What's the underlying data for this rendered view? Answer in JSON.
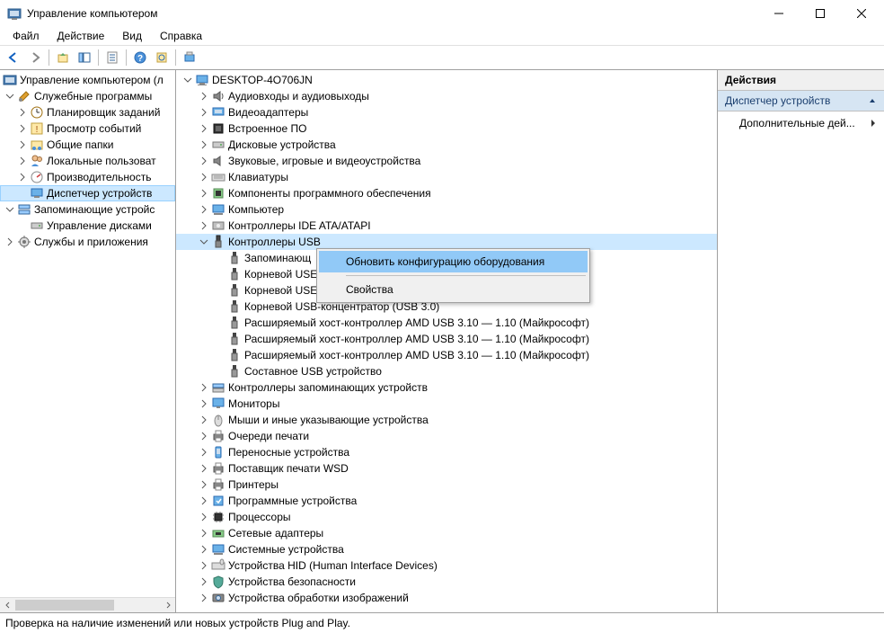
{
  "window": {
    "title": "Управление компьютером"
  },
  "menubar": {
    "file": "Файл",
    "action": "Действие",
    "view": "Вид",
    "help": "Справка"
  },
  "left_tree": {
    "root": "Управление компьютером (л",
    "system_tools": "Служебные программы",
    "task_scheduler": "Планировщик заданий",
    "event_viewer": "Просмотр событий",
    "shared_folders": "Общие папки",
    "local_users": "Локальные пользоват",
    "performance": "Производительность",
    "device_manager": "Диспетчер устройств",
    "storage": "Запоминающие устройс",
    "disk_mgmt": "Управление дисками",
    "services_apps": "Службы и приложения"
  },
  "device_tree": {
    "computer": "DESKTOP-4O706JN",
    "audio": "Аудиовходы и аудиовыходы",
    "video": "Видеоадаптеры",
    "firmware": "Встроенное ПО",
    "disk": "Дисковые устройства",
    "sound": "Звуковые, игровые и видеоустройства",
    "keyboards": "Клавиатуры",
    "software_components": "Компоненты программного обеспечения",
    "computer_cat": "Компьютер",
    "ide": "Контроллеры IDE ATA/ATAPI",
    "usb_controllers": "Контроллеры USB",
    "usb_mass": "Запоминающ",
    "usb_root1": "Корневой USE",
    "usb_root2": "Корневой USE",
    "usb_root3": "Корневой USB-концентратор (USB 3.0)",
    "usb_amd1": "Расширяемый хост-контроллер AMD USB 3.10 — 1.10 (Майкрософт)",
    "usb_amd2": "Расширяемый хост-контроллер AMD USB 3.10 — 1.10 (Майкрософт)",
    "usb_amd3": "Расширяемый хост-контроллер AMD USB 3.10 — 1.10 (Майкрософт)",
    "usb_composite": "Составное USB устройство",
    "storage_ctrl": "Контроллеры запоминающих устройств",
    "monitors": "Мониторы",
    "mice": "Мыши и иные указывающие устройства",
    "print_queues": "Очереди печати",
    "portable": "Переносные устройства",
    "wsd": "Поставщик печати WSD",
    "printers": "Принтеры",
    "software_devices": "Программные устройства",
    "processors": "Процессоры",
    "network": "Сетевые адаптеры",
    "system_devices": "Системные устройства",
    "hid": "Устройства HID (Human Interface Devices)",
    "security": "Устройства безопасности",
    "imaging": "Устройства обработки изображений"
  },
  "context_menu": {
    "scan": "Обновить конфигурацию оборудования",
    "properties": "Свойства"
  },
  "actions": {
    "header": "Действия",
    "section": "Диспетчер устройств",
    "more": "Дополнительные дей..."
  },
  "statusbar": {
    "text": "Проверка на наличие изменений или новых устройств Plug and Play."
  }
}
